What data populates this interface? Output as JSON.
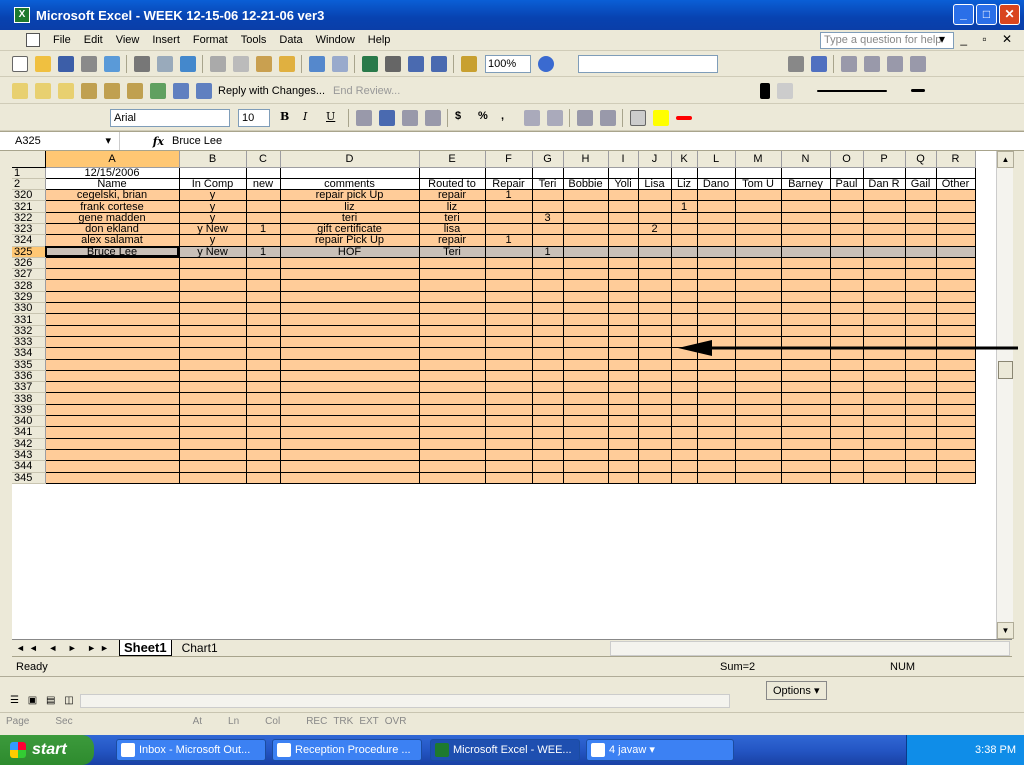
{
  "window": {
    "title": "Microsoft Excel - WEEK 12-15-06 12-21-06 ver3",
    "app_icon": "X"
  },
  "menu": {
    "items": [
      "File",
      "Edit",
      "View",
      "Insert",
      "Format",
      "Tools",
      "Data",
      "Window",
      "Help"
    ],
    "help_placeholder": "Type a question for help"
  },
  "toolbar": {
    "zoom": "100%",
    "reply_with_changes": "Reply with Changes...",
    "end_review": "End Review...",
    "font": "Arial",
    "font_size": "10"
  },
  "formula": {
    "cell_ref": "A325",
    "value": "Bruce Lee"
  },
  "columns": [
    "A",
    "B",
    "C",
    "D",
    "E",
    "F",
    "G",
    "H",
    "I",
    "J",
    "K",
    "L",
    "M",
    "N",
    "O",
    "P",
    "Q",
    "R"
  ],
  "rows": [
    {
      "num": "1",
      "cells": [
        "12/15/2006",
        "",
        "",
        "",
        "",
        "",
        "",
        "",
        "",
        "",
        "",
        "",
        "",
        "",
        "",
        "",
        "",
        ""
      ]
    },
    {
      "num": "2",
      "cells": [
        "Name",
        "In Comp",
        "new",
        "comments",
        "Routed to",
        "Repair",
        "Teri",
        "Bobbie",
        "Yoli",
        "Lisa",
        "Liz",
        "Dano",
        "Tom U",
        "Barney",
        "Paul",
        "Dan R",
        "Gail",
        "Other"
      ]
    },
    {
      "num": "320",
      "cells": [
        "cegelski, brian",
        "y",
        "",
        "repair pick Up",
        "repair",
        "1",
        "",
        "",
        "",
        "",
        "",
        "",
        "",
        "",
        "",
        "",
        "",
        ""
      ]
    },
    {
      "num": "321",
      "cells": [
        "frank cortese",
        "y",
        "",
        "liz",
        "liz",
        "",
        "",
        "",
        "",
        "",
        "1",
        "",
        "",
        "",
        "",
        "",
        "",
        ""
      ]
    },
    {
      "num": "322",
      "cells": [
        "gene madden",
        "y",
        "",
        "teri",
        "teri",
        "",
        "3",
        "",
        "",
        "",
        "",
        "",
        "",
        "",
        "",
        "",
        "",
        ""
      ]
    },
    {
      "num": "323",
      "cells": [
        "don ekland",
        "y New",
        "1",
        "gift certificate",
        "lisa",
        "",
        "",
        "",
        "",
        "2",
        "",
        "",
        "",
        "",
        "",
        "",
        "",
        ""
      ]
    },
    {
      "num": "324",
      "cells": [
        "alex salamat",
        "y",
        "",
        "repair Pick Up",
        "repair",
        "1",
        "",
        "",
        "",
        "",
        "",
        "",
        "",
        "",
        "",
        "",
        "",
        ""
      ]
    },
    {
      "num": "325",
      "cells": [
        "Bruce Lee",
        "y New",
        "1",
        "HOF",
        "Teri",
        "",
        "1",
        "",
        "",
        "",
        "",
        "",
        "",
        "",
        "",
        "",
        "",
        ""
      ]
    },
    {
      "num": "326",
      "cells": []
    },
    {
      "num": "327",
      "cells": []
    },
    {
      "num": "328",
      "cells": []
    },
    {
      "num": "329",
      "cells": []
    },
    {
      "num": "330",
      "cells": []
    },
    {
      "num": "331",
      "cells": []
    },
    {
      "num": "332",
      "cells": []
    },
    {
      "num": "333",
      "cells": []
    },
    {
      "num": "334",
      "cells": []
    },
    {
      "num": "335",
      "cells": []
    },
    {
      "num": "336",
      "cells": []
    },
    {
      "num": "337",
      "cells": []
    },
    {
      "num": "338",
      "cells": []
    },
    {
      "num": "339",
      "cells": []
    },
    {
      "num": "340",
      "cells": []
    },
    {
      "num": "341",
      "cells": []
    },
    {
      "num": "342",
      "cells": []
    },
    {
      "num": "343",
      "cells": []
    },
    {
      "num": "344",
      "cells": []
    },
    {
      "num": "345",
      "cells": []
    }
  ],
  "active_row": "325",
  "sheet_tabs": [
    "Sheet1",
    "Chart1"
  ],
  "status": {
    "ready": "Ready",
    "sum": "Sum=2",
    "num": "NUM"
  },
  "word_status": {
    "page": "Page",
    "sec": "Sec",
    "at": "At",
    "ln": "Ln",
    "col": "Col",
    "rec": "REC",
    "trk": "TRK",
    "ext": "EXT",
    "ovr": "OVR"
  },
  "options_label": "Options",
  "taskbar": {
    "start": "start",
    "tasks": [
      "Inbox - Microsoft Out...",
      "Reception Procedure ...",
      "Microsoft Excel - WEE...",
      "4 javaw"
    ],
    "clock": "3:38 PM"
  },
  "colors": {
    "peach": "#ffcc99",
    "header": "#ece9d8",
    "selected_header": "#ffc773"
  }
}
